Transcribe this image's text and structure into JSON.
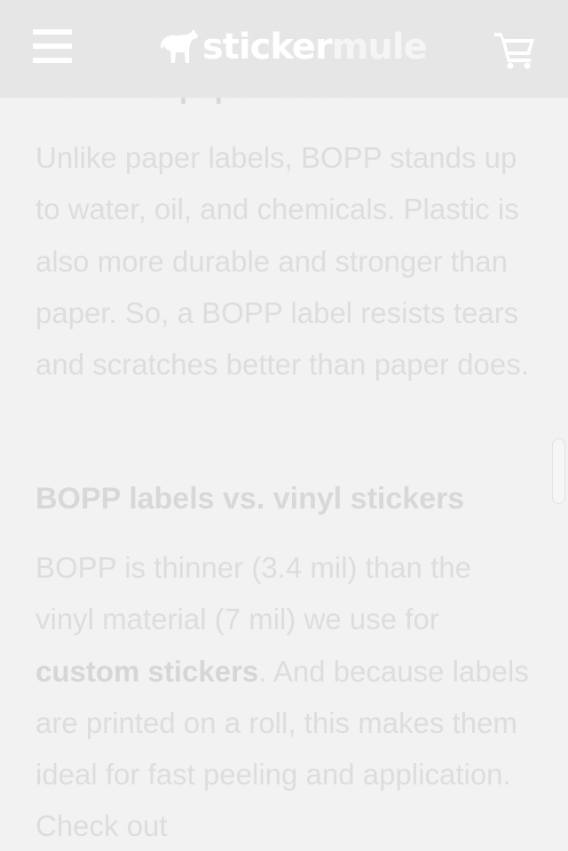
{
  "header": {
    "brand_part1": "sticker",
    "brand_part2": "mule"
  },
  "article": {
    "heading_top_partial": "BOPP vs. paper labels",
    "paragraph1": "Unlike paper labels, BOPP stands up to water, oil, and chemicals. Plastic is also more durable and stronger than paper. So, a BOPP label resists tears and scratches better than paper does.",
    "heading2": "BOPP labels vs. vinyl stickers",
    "paragraph2_before": "BOPP is thinner (3.4 mil) than the vinyl material (7 mil) we use for ",
    "paragraph2_link": "custom stickers",
    "paragraph2_after": ". And because labels are printed on a roll, this makes them ideal for fast peeling and application. Check out"
  },
  "icons": {
    "menu": "hamburger-menu-icon",
    "logo": "mule-logo-icon",
    "cart": "shopping-cart-icon"
  },
  "colors": {
    "header_bg": "#e6e6e6",
    "page_bg": "#f2f2f2",
    "text": "#dddddd"
  }
}
